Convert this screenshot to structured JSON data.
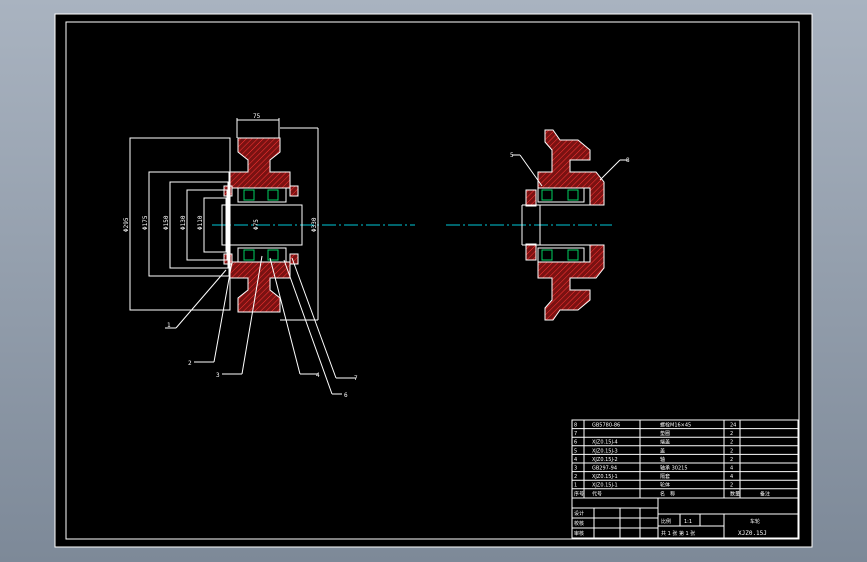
{
  "drawing_number": "XJZ0.15J",
  "scale": "1:1",
  "dimensions": {
    "top_width": "75",
    "d295": "Φ295",
    "d175": "Φ175",
    "d150": "Φ150",
    "d130": "Φ130",
    "d110": "Φ110",
    "d75": "Φ75",
    "d330": "Φ330"
  },
  "callouts_left": [
    "1",
    "2",
    "3",
    "4",
    "7",
    "6"
  ],
  "callouts_right": [
    "5",
    "8"
  ],
  "bom": [
    {
      "no": "8",
      "code": "GB5780-86",
      "name": "螺栓M16×45",
      "qty": "24"
    },
    {
      "no": "7",
      "code": "",
      "name": "垫圈",
      "qty": "2"
    },
    {
      "no": "6",
      "code": "XJZ0.15J-4",
      "name": "端盖",
      "qty": "2"
    },
    {
      "no": "5",
      "code": "XJZ0.15J-3",
      "name": "盖",
      "qty": "2"
    },
    {
      "no": "4",
      "code": "XJZ0.15J-2",
      "name": "轴",
      "qty": "2"
    },
    {
      "no": "3",
      "code": "GB297-94",
      "name": "轴承 30215",
      "qty": "4"
    },
    {
      "no": "2",
      "code": "XJZ0.15J-1",
      "name": "隔套",
      "qty": "4"
    },
    {
      "no": "1",
      "code": "XJZ0.15J-1",
      "name": "轮体",
      "qty": "2"
    }
  ],
  "bom_header": {
    "no": "序号",
    "code": "代号",
    "name": "名　称",
    "qty": "数量",
    "note": "备注"
  },
  "title_block": {
    "design": "设计",
    "check": "校核",
    "approve": "审核",
    "scale_label": "比例",
    "sheet": "共 1 张  第 1 张",
    "unit": "车轮"
  }
}
